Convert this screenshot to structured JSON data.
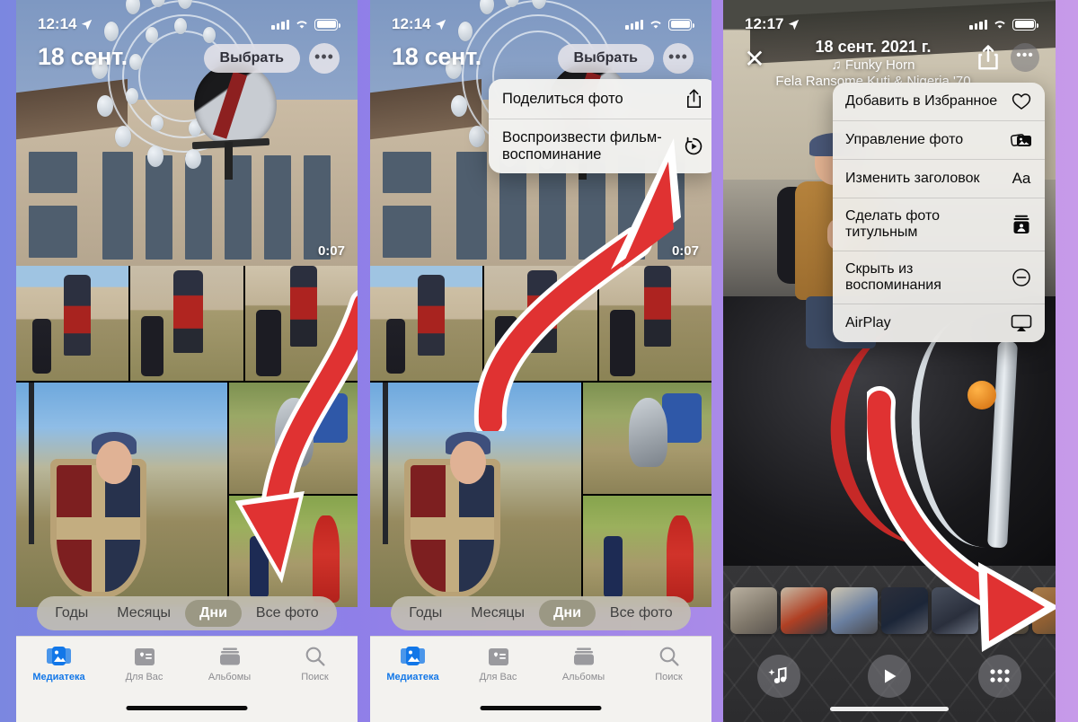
{
  "colors": {
    "accent_red": "#e03232",
    "tab_active_blue": "#1277e8",
    "separator_purple": "#8f7fe8",
    "edge_right_purple": "#c79ae9"
  },
  "panels": [
    {
      "id": "panel-1",
      "name": "photos-days-view",
      "status_bar": {
        "time": "12:14",
        "location_icon": "location-arrow-icon",
        "signal_icon": "cellular-bars-icon",
        "wifi_icon": "wifi-icon",
        "battery_icon": "battery-icon"
      },
      "hero": {
        "date_title": "18 сент.",
        "select_label": "Выбрать",
        "more_label": "•••",
        "duration": "0:07"
      },
      "segmented": {
        "options": [
          "Годы",
          "Месяцы",
          "Дни",
          "Все фото"
        ],
        "selected": "Дни"
      },
      "tabs": [
        {
          "label": "Медиатека",
          "icon": "photos-library-icon",
          "active": true
        },
        {
          "label": "Для Вас",
          "icon": "for-you-icon",
          "active": false
        },
        {
          "label": "Альбомы",
          "icon": "albums-icon",
          "active": false
        },
        {
          "label": "Поиск",
          "icon": "search-icon",
          "active": false
        }
      ]
    },
    {
      "id": "panel-2",
      "name": "photos-days-view-context-menu",
      "status_bar": {
        "time": "12:14"
      },
      "hero": {
        "date_title": "18 сент.",
        "select_label": "Выбрать",
        "more_label": "•••",
        "duration": "0:07"
      },
      "context_menu": [
        {
          "label": "Поделиться фото",
          "icon": "share-icon"
        },
        {
          "label": "Воспроизвести фильм-воспоминание",
          "icon": "play-memory-icon"
        }
      ],
      "segmented": {
        "options": [
          "Годы",
          "Месяцы",
          "Дни",
          "Все фото"
        ],
        "selected": "Дни"
      },
      "tabs": [
        {
          "label": "Медиатека",
          "icon": "photos-library-icon",
          "active": true
        },
        {
          "label": "Для Вас",
          "icon": "for-you-icon",
          "active": false
        },
        {
          "label": "Альбомы",
          "icon": "albums-icon",
          "active": false
        },
        {
          "label": "Поиск",
          "icon": "search-icon",
          "active": false
        }
      ]
    },
    {
      "id": "panel-3",
      "name": "memory-player-context-menu",
      "status_bar": {
        "time": "12:17"
      },
      "header": {
        "close_icon": "close-icon",
        "date": "18 сент. 2021 г.",
        "song": "♫ Funky Horn",
        "artist": "Fela Ransome Kuti & Nigeria '70",
        "share_icon": "share-icon",
        "more_label": "•••"
      },
      "menu": [
        {
          "label": "Добавить в Избранное",
          "icon": "heart-icon"
        },
        {
          "label": "Управление фото",
          "icon": "manage-photos-icon"
        },
        {
          "label": "Изменить заголовок",
          "icon": "text-format-icon"
        },
        {
          "label": "Сделать фото титульным",
          "icon": "key-photo-icon"
        },
        {
          "label": "Скрыть из воспоминания",
          "icon": "minus-circle-icon"
        },
        {
          "label": "AirPlay",
          "icon": "airplay-icon"
        }
      ],
      "controls": [
        {
          "name": "music-button",
          "icon": "music-sparkle-icon"
        },
        {
          "name": "play-button",
          "icon": "play-icon"
        },
        {
          "name": "grid-button",
          "icon": "grid-icon"
        }
      ]
    }
  ]
}
